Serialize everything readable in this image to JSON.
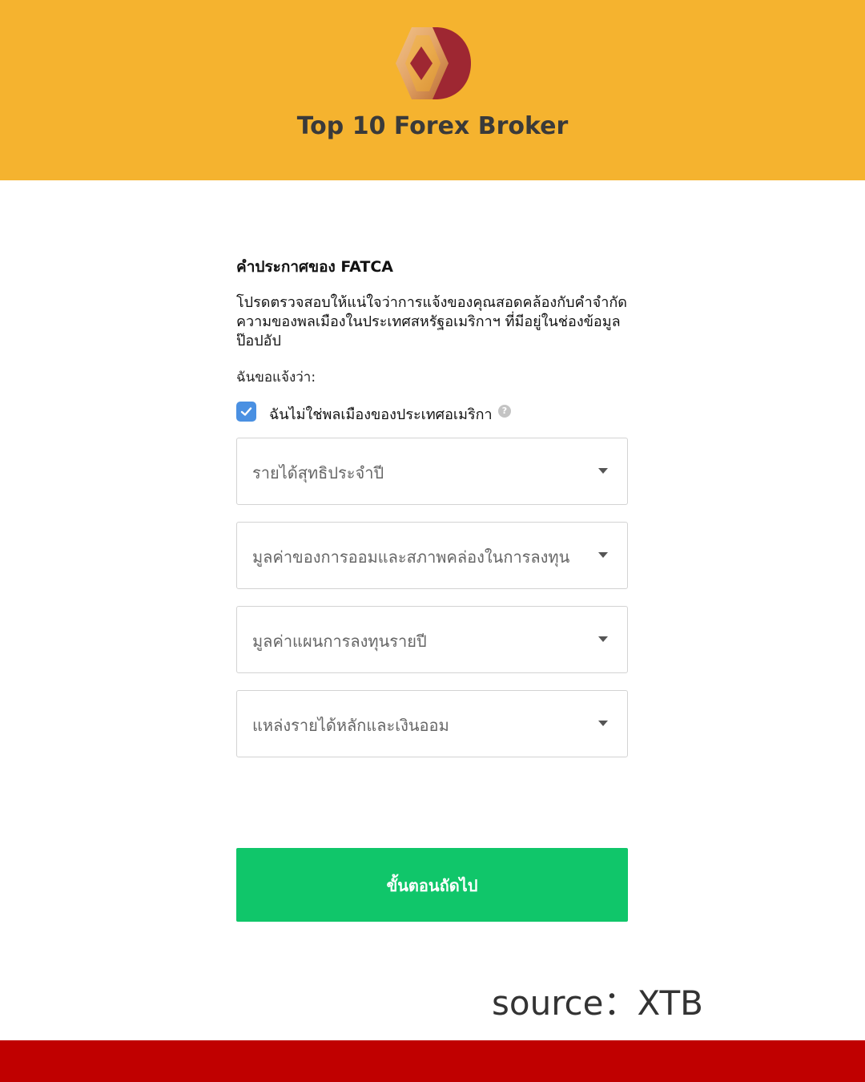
{
  "header": {
    "brand": "Top 10 Forex Broker",
    "logo": "diamond-d-logo",
    "background_color": "#F5B32F"
  },
  "form": {
    "title": "คำประกาศของ FATCA",
    "description": "โปรดตรวจสอบให้แน่ใจว่าการแจ้งของคุณสอดคล้องกับคำจำกัดความของพลเมืองในประเทศสหรัฐอเมริกาฯ ที่มีอยู่ในช่องข้อมูลป๊อปอัป",
    "declare_label": "ฉันขอแจ้งว่า:",
    "checkbox": {
      "label": "ฉันไม่ใช่พลเมืองของประเทศอเมริกา",
      "checked": true,
      "help_icon": "question-icon",
      "help_glyph": "?"
    },
    "selects": [
      {
        "placeholder": "รายได้สุทธิประจำปี"
      },
      {
        "placeholder": "มูลค่าของการออมและสภาพคล่องในการลงทุน"
      },
      {
        "placeholder": "มูลค่าแผนการลงทุนรายปี"
      },
      {
        "placeholder": "แหล่งรายได้หลักและเงินออม"
      }
    ],
    "next_button": "ขั้นตอนถัดไป",
    "button_color": "#10C66A"
  },
  "source": "source：XTB",
  "footer_color": "#C00000"
}
